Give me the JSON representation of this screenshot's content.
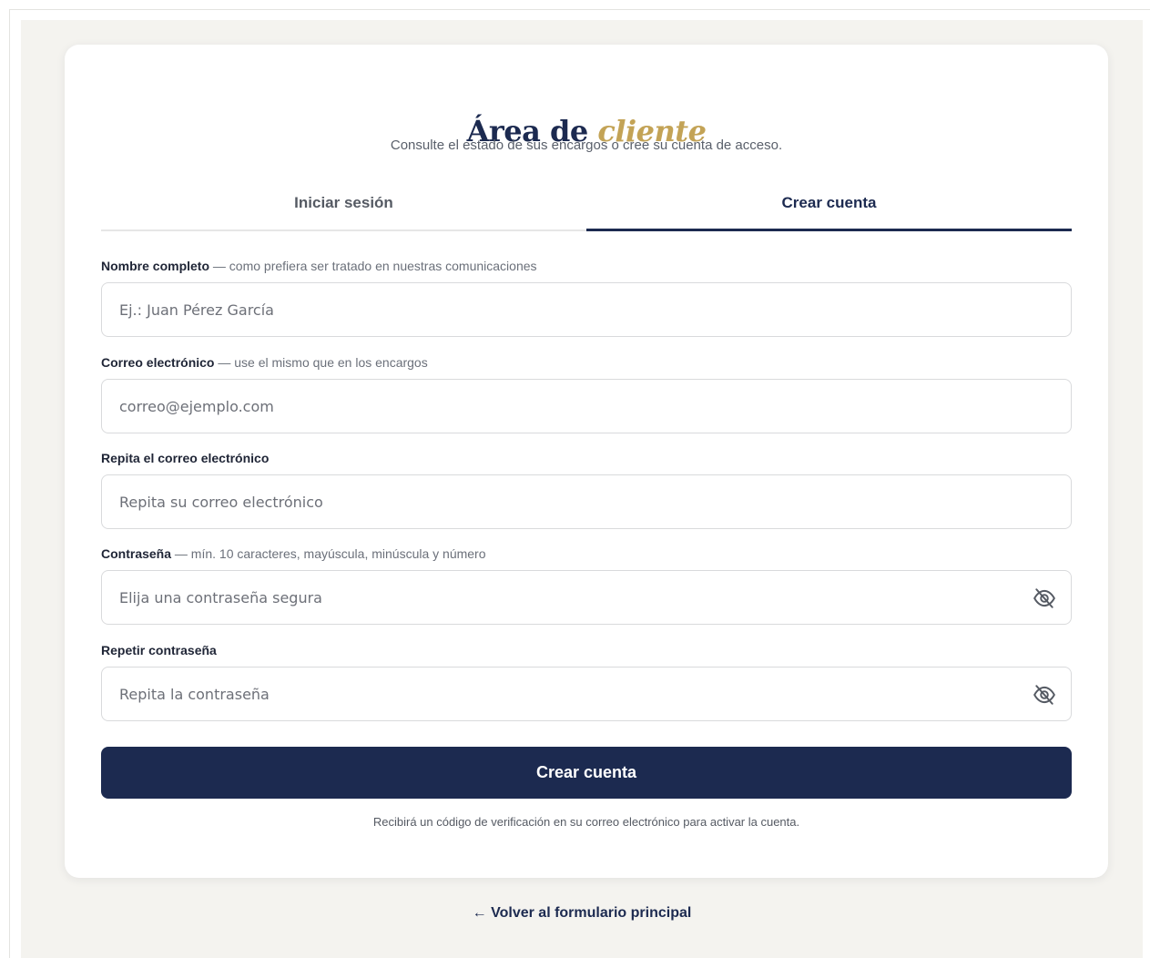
{
  "header": {
    "title_main": "Área de",
    "title_accent": "cliente",
    "subtitle": "Consulte el estado de sus encargos o cree su cuenta de acceso."
  },
  "tabs": [
    {
      "label": "Iniciar sesión",
      "active": false
    },
    {
      "label": "Crear cuenta",
      "active": true
    }
  ],
  "form": {
    "name": {
      "label": "Nombre completo",
      "hint": "— como prefiera ser tratado en nuestras comunicaciones",
      "placeholder": "Ej.: Juan Pérez García",
      "value": ""
    },
    "email": {
      "label": "Correo electrónico",
      "hint": "— use el mismo que en los encargos",
      "placeholder": "correo@ejemplo.com",
      "value": ""
    },
    "email_confirm": {
      "label": "Repita el correo electrónico",
      "hint": "",
      "placeholder": "Repita su correo electrónico",
      "value": ""
    },
    "password": {
      "label": "Contraseña",
      "hint": "— mín. 10 caracteres, mayúscula, minúscula y número",
      "placeholder": "Elija una contraseña segura",
      "value": "",
      "icon": "eye-off-icon"
    },
    "password_confirm": {
      "label": "Repetir contraseña",
      "hint": "",
      "placeholder": "Repita la contraseña",
      "value": "",
      "icon": "eye-off-icon"
    },
    "submit_label": "Crear cuenta",
    "note": "Recibirá un código de verificación en su correo electrónico para activar la cuenta."
  },
  "footer": {
    "back_link": "← Volver al formulario principal"
  },
  "colors": {
    "primary": "#1c2a50",
    "accent": "#c3a356",
    "background": "#f4f3ef"
  }
}
